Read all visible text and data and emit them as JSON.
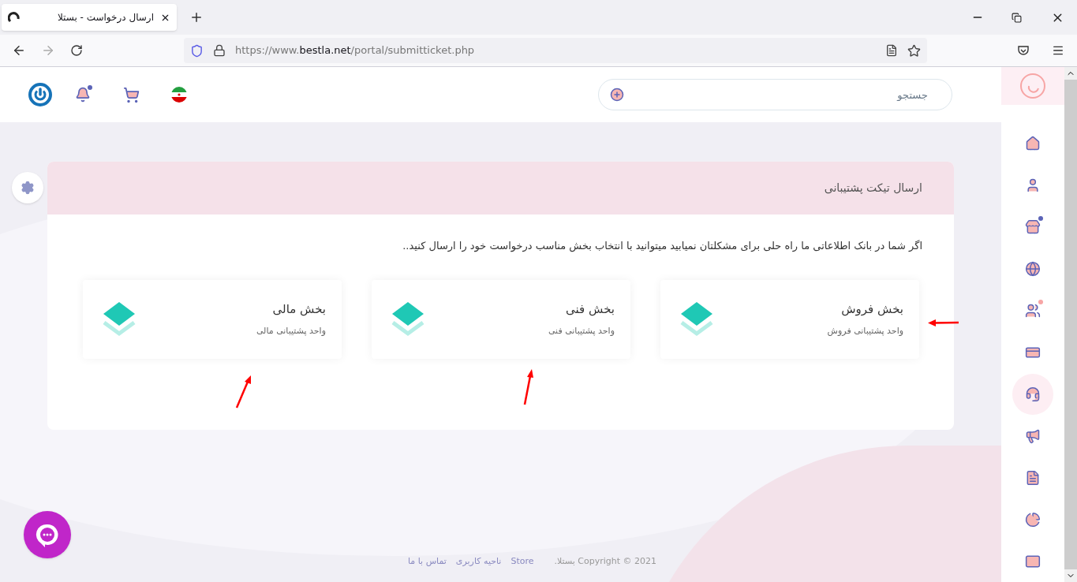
{
  "browser": {
    "tab_title": "ارسال درخواست - بستلا",
    "url_prefix": "https://www.",
    "url_domain": "bestla.net",
    "url_path": "/portal/submitticket.php"
  },
  "header": {
    "search_placeholder": "جستجو",
    "bell_unread": true
  },
  "ticket": {
    "title": "ارسال تیکت پشتیبانی",
    "intro": "اگر شما در بانک اطلاعاتی ما راه حلی برای مشکلتان نمیابید میتوانید با انتخاب بخش مناسب درخواست خود را ارسال کنید..",
    "departments": [
      {
        "name": "بخش فروش",
        "description": "واحد پشتیبانی فروش"
      },
      {
        "name": "بخش فنی",
        "description": "واحد پشتیبانی فنی"
      },
      {
        "name": "بخش مالی",
        "description": "واحد پشتیبانی مالی"
      }
    ]
  },
  "sidebar": {
    "items": [
      {
        "kind": "home",
        "selected": false
      },
      {
        "kind": "user",
        "selected": false
      },
      {
        "kind": "store",
        "selected": false,
        "color": "#5b63b7"
      },
      {
        "kind": "globe",
        "selected": false
      },
      {
        "kind": "users",
        "selected": false,
        "color": "#f7a5a5"
      },
      {
        "kind": "card",
        "selected": false
      },
      {
        "kind": "support",
        "selected": true
      },
      {
        "kind": "megaphone",
        "selected": false
      },
      {
        "kind": "document",
        "selected": false
      },
      {
        "kind": "chart",
        "selected": false
      },
      {
        "kind": "mail",
        "selected": false
      }
    ]
  },
  "footer": {
    "copyright": "Copyright © 2021 بستلا.",
    "links": [
      "Store",
      "ناحیه کاربری",
      "تماس با ما"
    ]
  }
}
